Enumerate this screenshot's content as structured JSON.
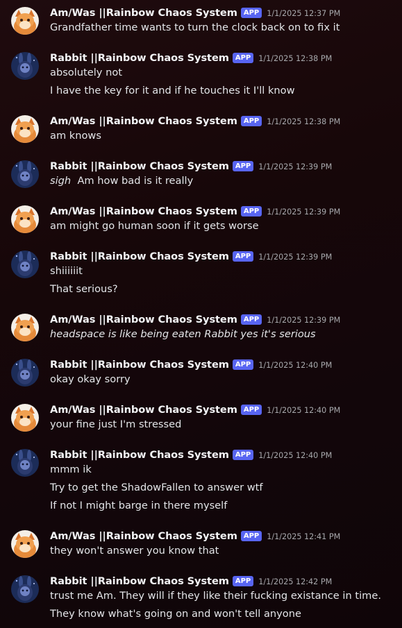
{
  "app_badge": "APP",
  "messages": [
    {
      "user": "Am/Was ||Rainbow Chaos System",
      "avatar": "fox-avatar",
      "time": "1/1/2025 12:37 PM",
      "lines": [
        "Grandfather time wants to turn the clock back on to fix it"
      ]
    },
    {
      "user": "Rabbit ||Rainbow Chaos System",
      "avatar": "rabbit-avatar",
      "time": "1/1/2025 12:38 PM",
      "lines": [
        "absolutely not",
        "I have the key for it and if he touches it I'll know"
      ]
    },
    {
      "user": "Am/Was ||Rainbow Chaos System",
      "avatar": "fox-avatar",
      "time": "1/1/2025 12:38 PM",
      "lines": [
        "am knows"
      ]
    },
    {
      "user": "Rabbit ||Rainbow Chaos System",
      "avatar": "rabbit-avatar",
      "time": "1/1/2025 12:39 PM",
      "lines": [],
      "em": "sigh",
      "rest": "  Am how bad is it really"
    },
    {
      "user": "Am/Was ||Rainbow Chaos System",
      "avatar": "fox-avatar",
      "time": "1/1/2025 12:39 PM",
      "lines": [
        "am might go human soon if it gets worse"
      ]
    },
    {
      "user": "Rabbit ||Rainbow Chaos System",
      "avatar": "rabbit-avatar",
      "time": "1/1/2025 12:39 PM",
      "lines": [
        "shiiiiiit",
        "That serious?"
      ]
    },
    {
      "user": "Am/Was ||Rainbow Chaos System",
      "avatar": "fox-avatar",
      "time": "1/1/2025 12:39 PM",
      "lines": [],
      "em": "headspace is like being eaten Rabbit yes it's serious",
      "rest": ""
    },
    {
      "user": "Rabbit ||Rainbow Chaos System",
      "avatar": "rabbit-avatar",
      "time": "1/1/2025 12:40 PM",
      "lines": [
        "okay okay sorry"
      ]
    },
    {
      "user": "Am/Was ||Rainbow Chaos System",
      "avatar": "fox-avatar",
      "time": "1/1/2025 12:40 PM",
      "lines": [
        "your fine just I'm stressed"
      ]
    },
    {
      "user": "Rabbit ||Rainbow Chaos System",
      "avatar": "rabbit-avatar",
      "time": "1/1/2025 12:40 PM",
      "lines": [
        "mmm ik",
        "Try to get the ShadowFallen to answer wtf",
        "If not I might barge in there myself"
      ]
    },
    {
      "user": "Am/Was ||Rainbow Chaos System",
      "avatar": "fox-avatar",
      "time": "1/1/2025 12:41 PM",
      "lines": [
        "they won't answer you know that"
      ]
    },
    {
      "user": "Rabbit ||Rainbow Chaos System",
      "avatar": "rabbit-avatar",
      "time": "1/1/2025 12:42 PM",
      "lines": [
        "trust me Am. They will if they like their fucking existance in time.",
        "They know what's going on and won't tell anyone"
      ]
    }
  ]
}
